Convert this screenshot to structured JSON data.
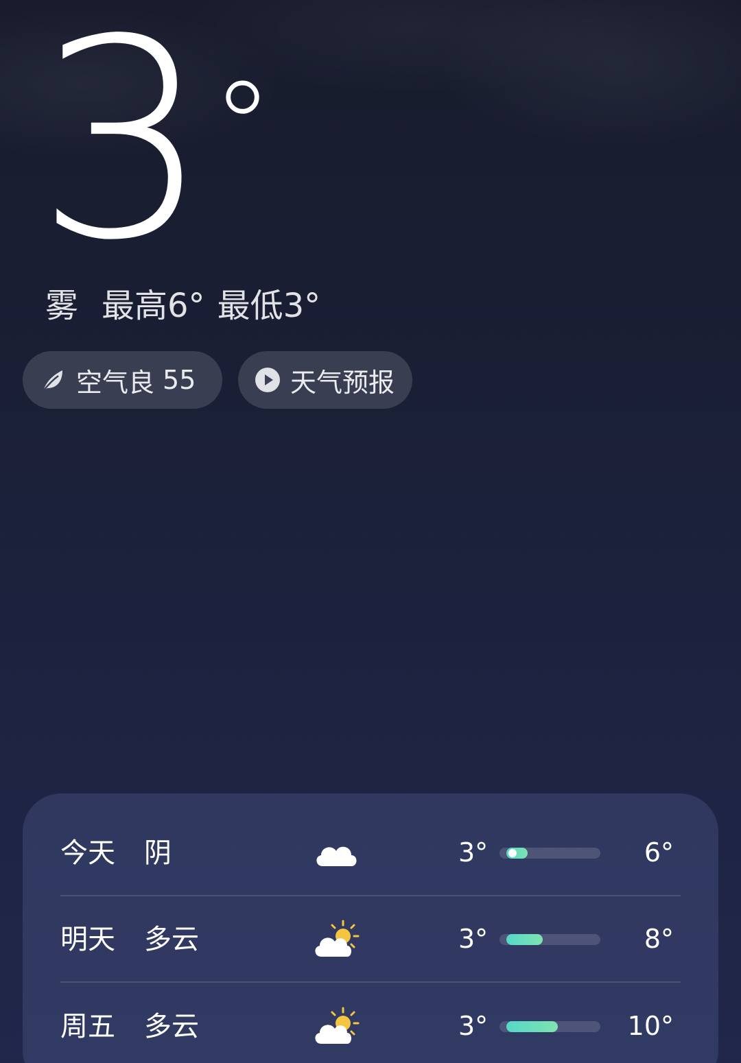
{
  "current": {
    "temperature": "3",
    "degree_symbol": "°",
    "condition": "雾",
    "high_text": "最高6°",
    "low_text": "最低3°"
  },
  "chips": {
    "aqi_label": "空气良",
    "aqi_value": "55",
    "forecast_label": "天气预报"
  },
  "daily": [
    {
      "day": "今天",
      "condition": "阴",
      "icon": "cloud-icon",
      "low": "3°",
      "high": "6°",
      "range_start": 0.07,
      "range_end": 0.28,
      "current_marker": 0.13
    },
    {
      "day": "明天",
      "condition": "多云",
      "icon": "partly-cloudy-icon",
      "low": "3°",
      "high": "8°",
      "range_start": 0.07,
      "range_end": 0.43
    },
    {
      "day": "周五",
      "condition": "多云",
      "icon": "partly-cloudy-icon",
      "low": "3°",
      "high": "10°",
      "range_start": 0.07,
      "range_end": 0.58
    }
  ],
  "colors": {
    "bar_fill_start": "#55d8c8",
    "bar_fill_end": "#7fe3b0",
    "sun": "#f5c542"
  }
}
